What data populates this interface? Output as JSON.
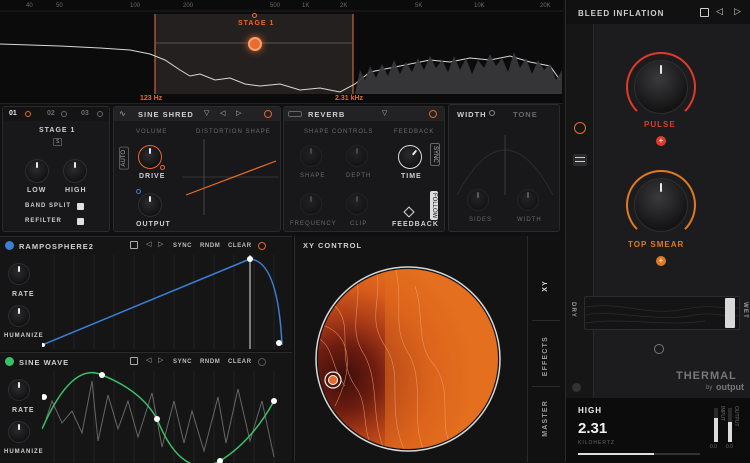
{
  "spectrum": {
    "freq_labels": [
      "40",
      "50",
      "100",
      "200",
      "500",
      "1K",
      "2K",
      "5K",
      "10K",
      "20K"
    ],
    "stage_label": "STAGE 1",
    "low_freq": "123 Hz",
    "high_freq": "2.31 kHz"
  },
  "stage_panel": {
    "tabs": [
      "01",
      "02",
      "03"
    ],
    "title": "STAGE 1",
    "solo": "S",
    "low": "LOW",
    "high": "HIGH",
    "band_split": "BAND SPLIT",
    "refilter": "REFILTER"
  },
  "sine_shred": {
    "title": "SINE SHRED",
    "volume": "VOLUME",
    "distortion_shape": "DISTORTION SHAPE",
    "auto": "AUTO",
    "drive": "DRIVE",
    "output": "OUTPUT"
  },
  "reverb": {
    "title": "REVERB",
    "shape_controls": "SHAPE CONTROLS",
    "feedback_head": "FEEDBACK",
    "shape": "SHAPE",
    "depth": "DEPTH",
    "frequency": "FREQUENCY",
    "clip": "CLIP",
    "time": "TIME",
    "feedback": "FEEDBACK",
    "sync": "SYNC",
    "follow": "FOLLOW"
  },
  "width_panel": {
    "tab_width": "WIDTH",
    "tab_tone": "TONE",
    "sides": "SIDES",
    "width": "WIDTH"
  },
  "mod1": {
    "title": "RAMPOSPHERE2",
    "sync": "SYNC",
    "rndm": "RNDM",
    "clear": "CLEAR",
    "rate": "RATE",
    "humanize": "HUMANIZE"
  },
  "mod2": {
    "title": "SINE WAVE",
    "sync": "SYNC",
    "rndm": "RNDM",
    "clear": "CLEAR",
    "rate": "RATE",
    "humanize": "HUMANIZE"
  },
  "xy": {
    "title": "XY CONTROL",
    "tabs": [
      "XY",
      "EFFECTS",
      "MASTER"
    ]
  },
  "preset": {
    "name": "BLEED INFLATION",
    "pulse": "PULSE",
    "top_smear": "TOP SMEAR",
    "dry": "DRY",
    "wet": "WET",
    "brand": "THERMAL",
    "brand_by": "by",
    "brand_company": "output"
  },
  "readout": {
    "param": "HIGH",
    "value": "2.31",
    "unit": "KILOHERTZ",
    "input": "INPUT",
    "output": "OUTPUT",
    "in_val": "0.0",
    "out_val": "0.0"
  },
  "colors": {
    "accent": "#e86a2c",
    "red": "#e23a2a",
    "orange": "#e07a20",
    "blue": "#3a7fd5",
    "green": "#3cc067"
  }
}
